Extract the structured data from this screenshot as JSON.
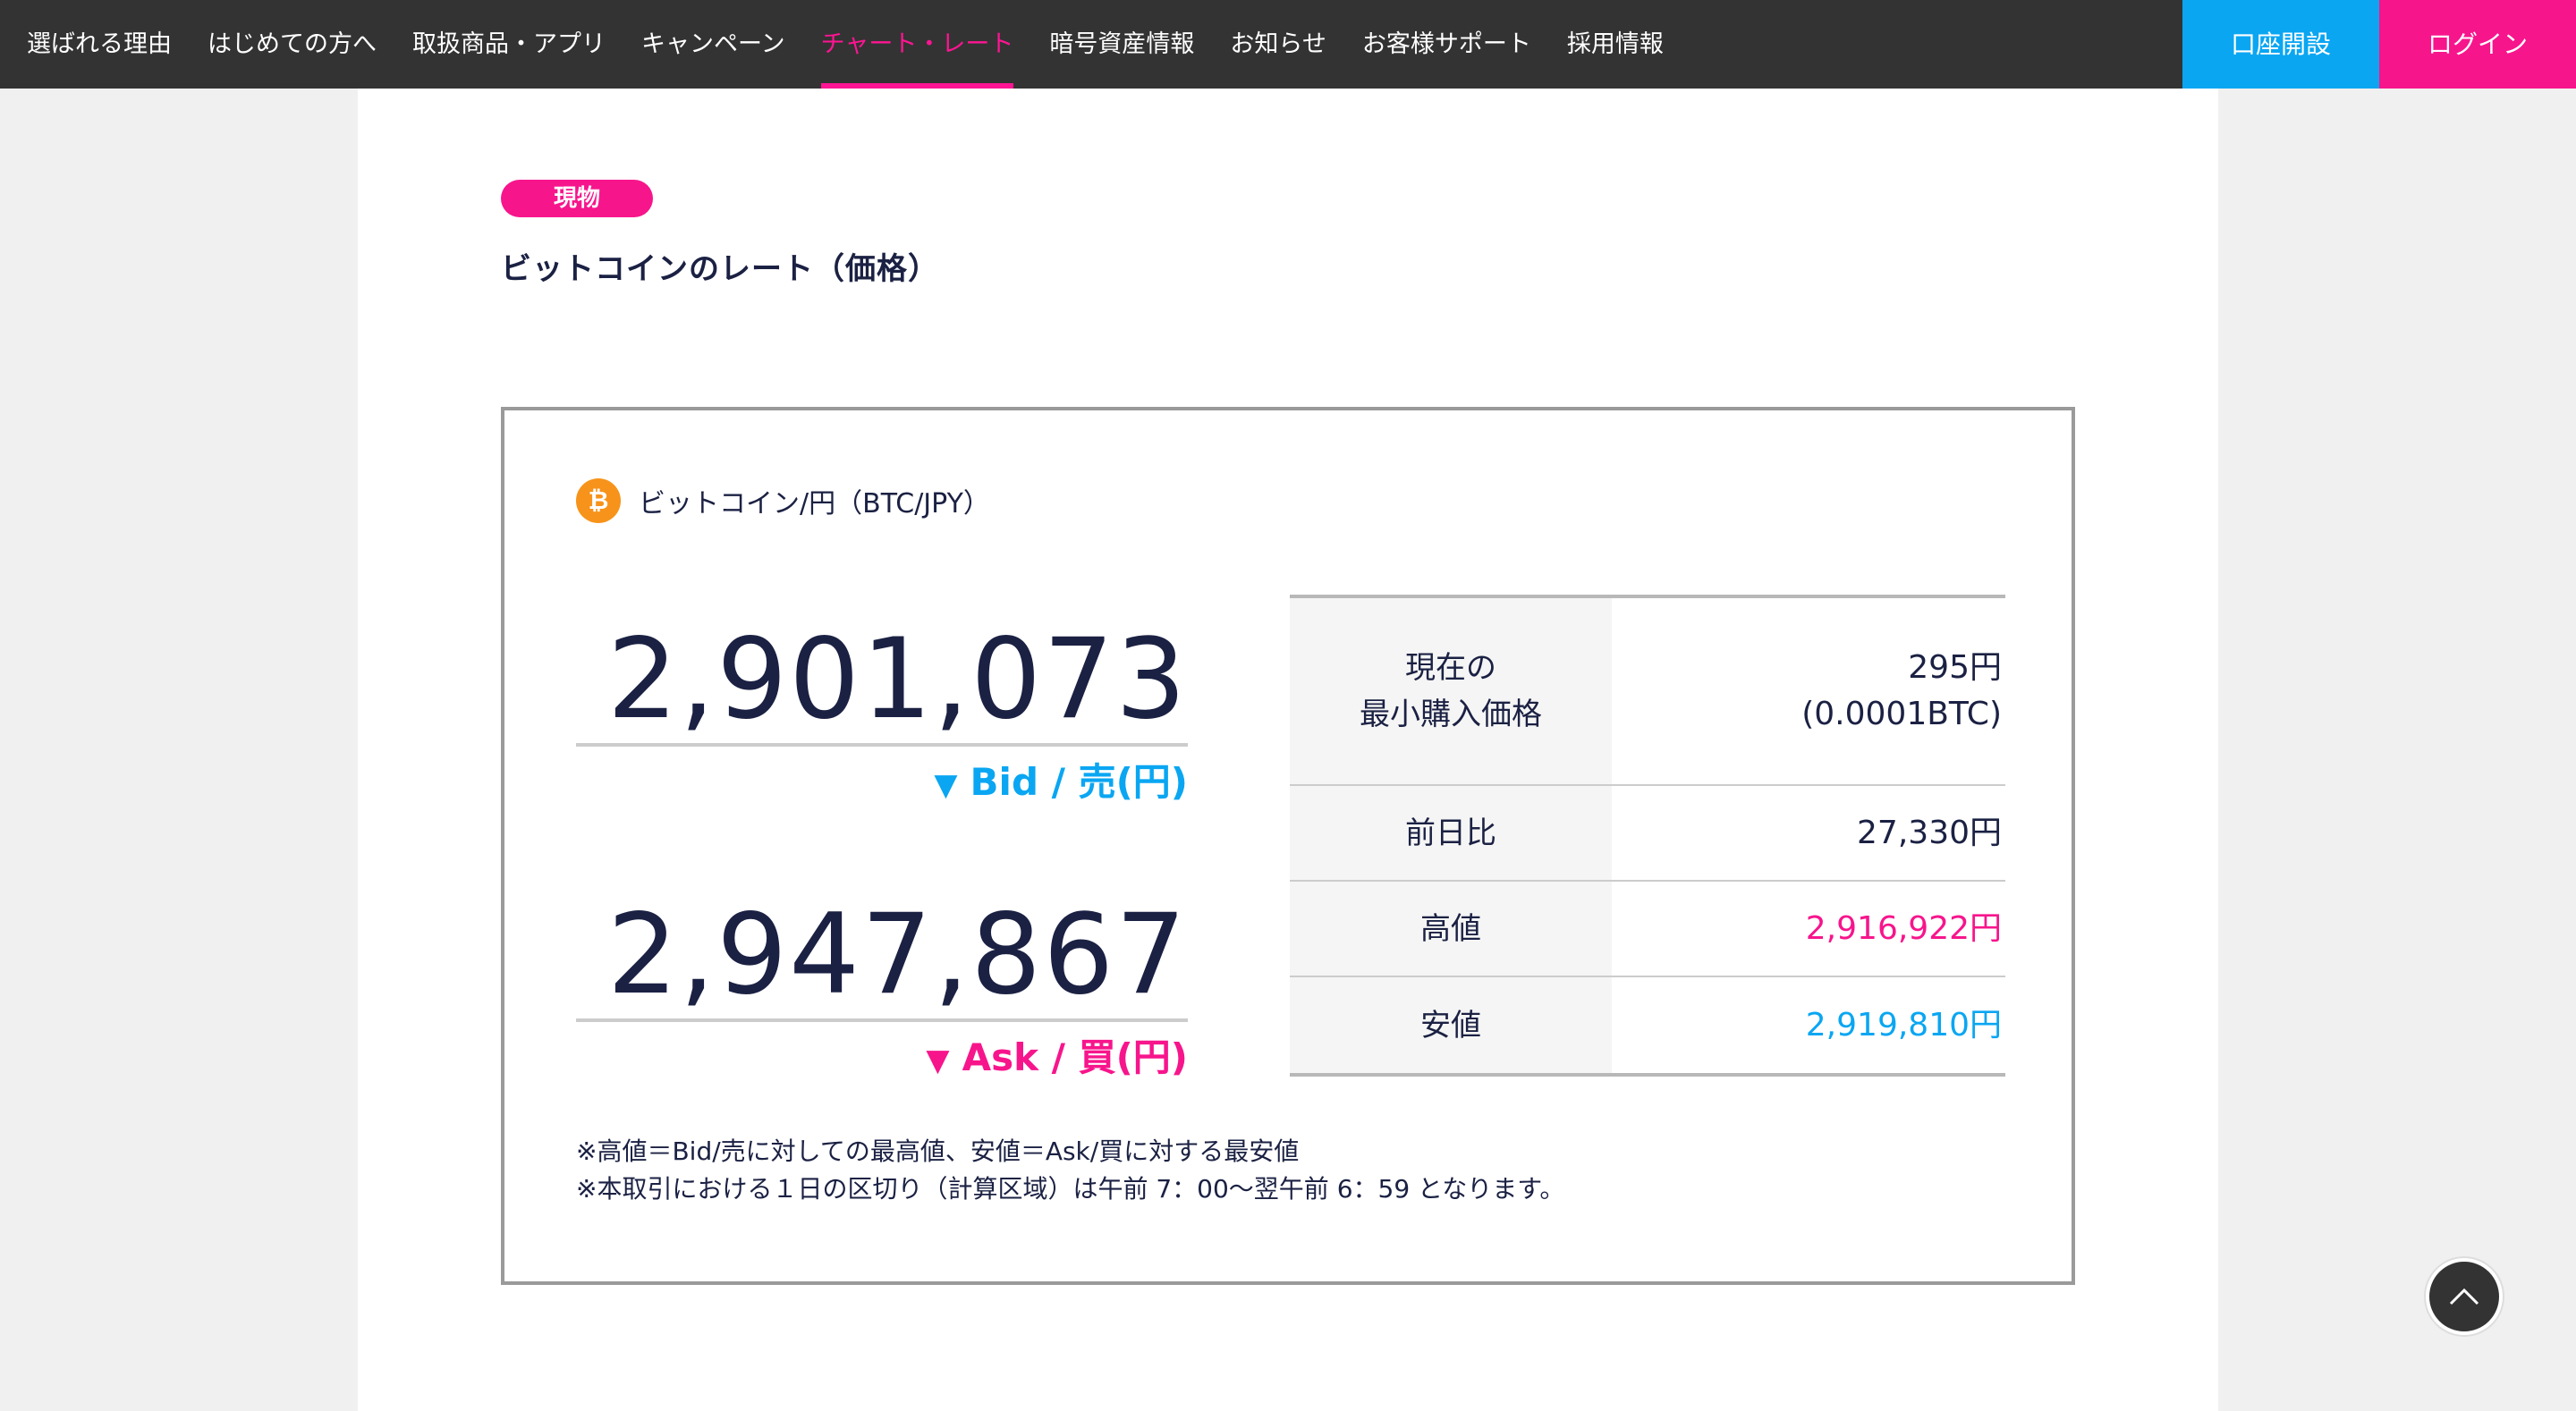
{
  "nav": {
    "items": [
      {
        "label": "選ばれる理由"
      },
      {
        "label": "はじめての方へ"
      },
      {
        "label": "取扱商品・アプリ"
      },
      {
        "label": "キャンペーン"
      },
      {
        "label": "チャート・レート",
        "active": true
      },
      {
        "label": "暗号資産情報"
      },
      {
        "label": "お知らせ"
      },
      {
        "label": "お客様サポート"
      },
      {
        "label": "採用情報"
      }
    ],
    "open_account": "口座開設",
    "login": "ログイン"
  },
  "page": {
    "badge": "現物",
    "title": "ビットコインのレート（価格）"
  },
  "pair": {
    "icon": "bitcoin-icon",
    "label": "ビットコイン/円（BTC/JPY）"
  },
  "bid": {
    "value": "2,901,073",
    "label": "Bid / 売(円)"
  },
  "ask": {
    "value": "2,947,867",
    "label": "Ask / 買(円)"
  },
  "stats": {
    "min_purchase_key": "現在の\n最小購入価格",
    "min_purchase_val": "295円\n(0.0001BTC)",
    "change_key": "前日比",
    "change_val": "27,330円",
    "high_key": "高値",
    "high_val": "2,916,922円",
    "low_key": "安値",
    "low_val": "2,919,810円"
  },
  "notes": {
    "line1": "※高値＝Bid/売に対しての最高値、安値＝Ask/買に対する最安値",
    "line2": "※本取引における１日の区切り（計算区域）は午前 7：00〜翌午前 6：59 となります。"
  },
  "colors": {
    "accent_pink": "#f7158c",
    "accent_blue": "#0aa6f2",
    "nav_bg": "#333333"
  }
}
